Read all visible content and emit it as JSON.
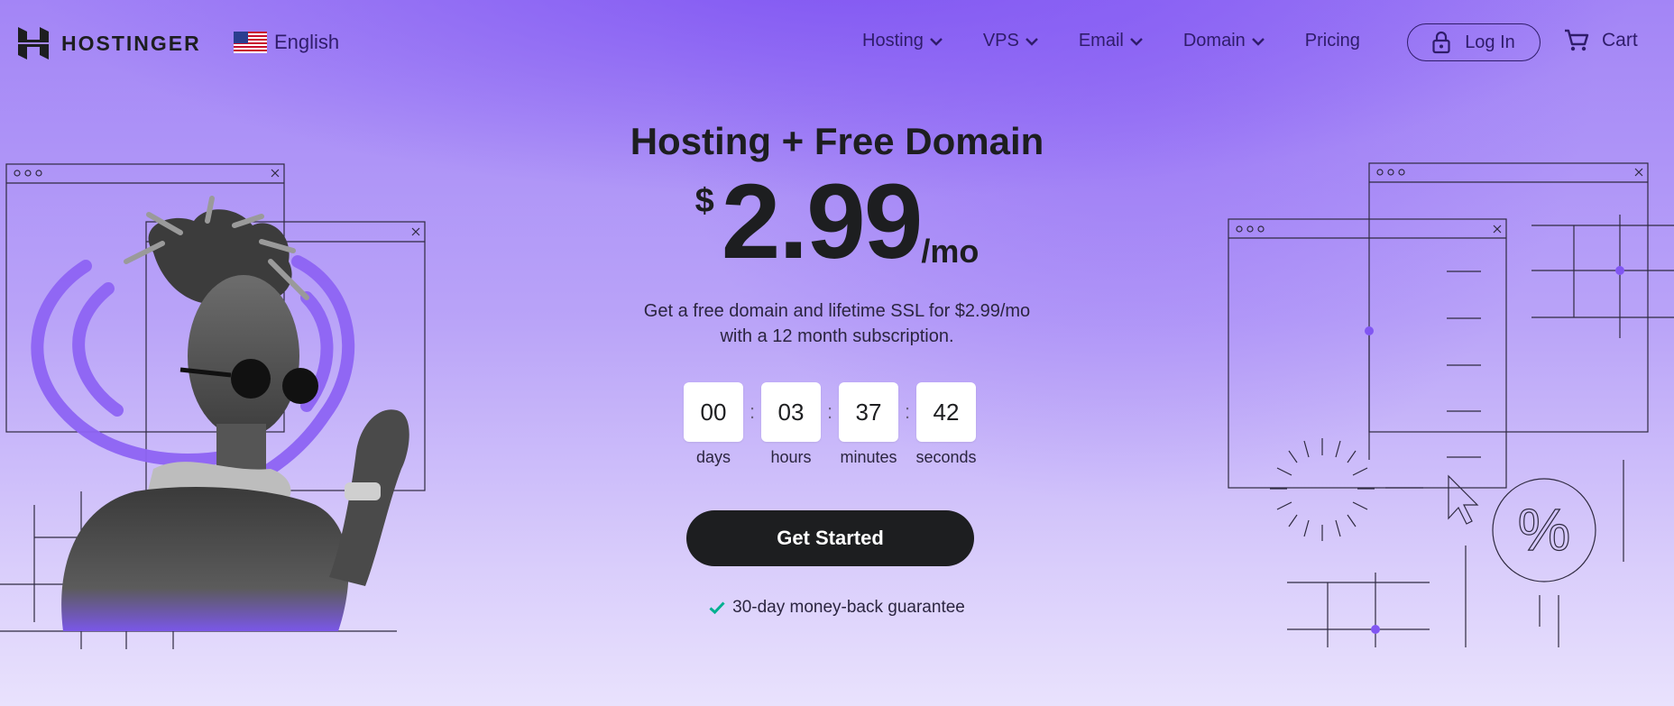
{
  "brand": {
    "name": "HOSTINGER",
    "icon": "hostinger-logo-icon"
  },
  "language": {
    "label": "English",
    "icon": "us-flag-icon"
  },
  "nav": {
    "items": [
      {
        "label": "Hosting",
        "has_dropdown": true
      },
      {
        "label": "VPS",
        "has_dropdown": true
      },
      {
        "label": "Email",
        "has_dropdown": true
      },
      {
        "label": "Domain",
        "has_dropdown": true
      },
      {
        "label": "Pricing",
        "has_dropdown": false
      }
    ],
    "login_label": "Log In",
    "cart_label": "Cart"
  },
  "hero": {
    "title": "Hosting + Free Domain",
    "price_currency": "$",
    "price_amount": "2.99",
    "price_period": "/mo",
    "subtitle_line1": "Get a free domain and lifetime SSL for $2.99/mo",
    "subtitle_line2": "with a 12 month subscription.",
    "countdown": [
      {
        "value": "00",
        "label": "days"
      },
      {
        "value": "03",
        "label": "hours"
      },
      {
        "value": "37",
        "label": "minutes"
      },
      {
        "value": "42",
        "label": "seconds"
      }
    ],
    "cta_label": "Get Started",
    "guarantee": "30-day money-back guarantee"
  },
  "colors": {
    "accent": "#8156f2",
    "dark": "#1d1e20",
    "nav_text": "#2f1c6a",
    "check": "#00b090"
  }
}
